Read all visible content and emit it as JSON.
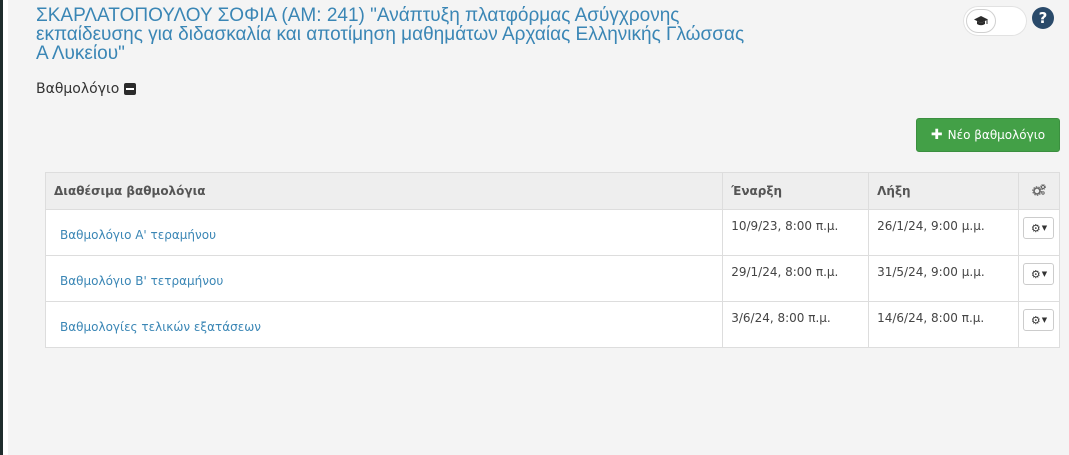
{
  "course": {
    "title": "ΣΚΑΡΛΑΤΟΠΟΥΛΟΥ ΣΟΦΙΑ (ΑΜ: 241) \"Ανάπτυξη πλατφόρμας Ασύγχρονης εκπαίδευσης για διδασκαλία και αποτίμηση μαθημάτων Αρχαίας Ελληνικής Γλώσσας Α Λυκείου\""
  },
  "header": {
    "help_label": "?"
  },
  "section": {
    "label": "Βαθμολόγιο"
  },
  "toolbar": {
    "new_label": "Νέο βαθμολόγιο"
  },
  "table": {
    "headers": {
      "name": "Διαθέσιμα βαθμολόγια",
      "start": "Έναρξη",
      "end": "Λήξη"
    },
    "rows": [
      {
        "name": "Βαθμολόγιο Α' τεραμήνου",
        "start": "10/9/23, 8:00 π.μ.",
        "end": "26/1/24, 9:00 μ.μ."
      },
      {
        "name": "Βαθμολόγιο Β' τετραμήνου",
        "start": "29/1/24, 8:00 π.μ.",
        "end": "31/5/24, 9:00 μ.μ."
      },
      {
        "name": "Βαθμολογίες τελικών εξατάσεων",
        "start": "3/6/24, 8:00 π.μ.",
        "end": "14/6/24, 8:00 π.μ."
      }
    ]
  },
  "icons": {
    "toggle": "graduation-cap-icon",
    "help": "question-circle-icon",
    "section": "minus-square-icon",
    "new": "plus-icon",
    "header_actions": "gears-icon",
    "row_actions": "gear-icon"
  },
  "colors": {
    "link": "#3a86b5",
    "primary_button": "#43a047",
    "help": "#2a4a6a"
  }
}
